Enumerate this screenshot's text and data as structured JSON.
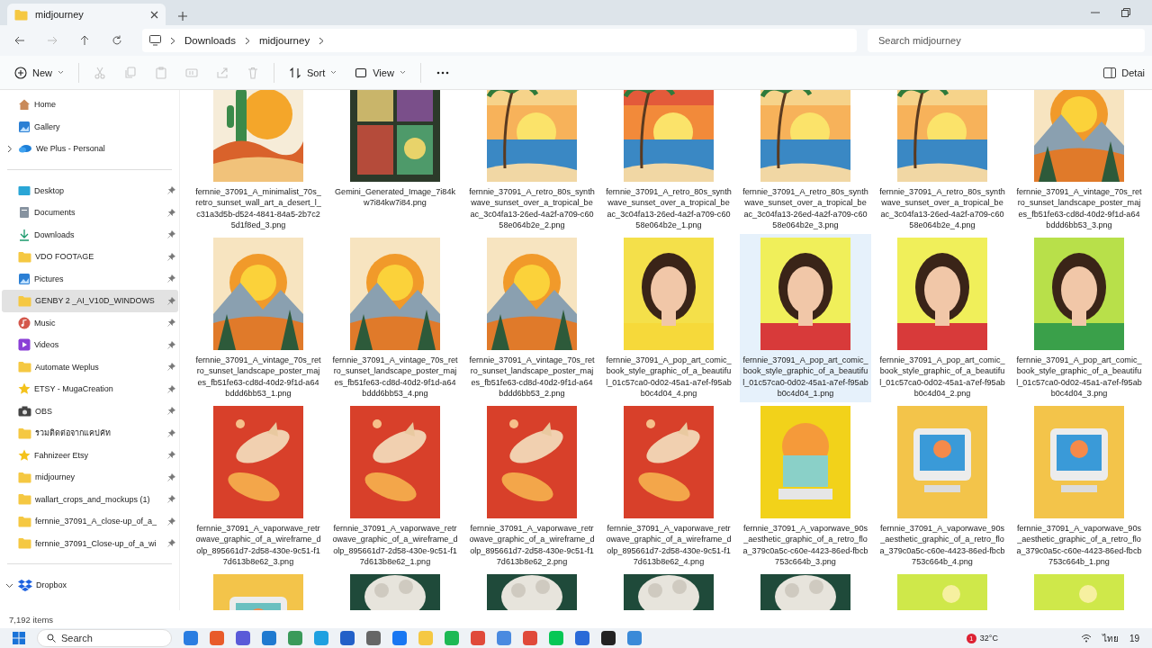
{
  "tab": {
    "title": "midjourney"
  },
  "address": {
    "crumbs": [
      "Downloads",
      "midjourney"
    ],
    "search": {
      "placeholder": "Search midjourney"
    }
  },
  "toolbar": [
    {
      "kind": "new",
      "label": "New",
      "disabled": false
    },
    {
      "kind": "cut",
      "disabled": true
    },
    {
      "kind": "copy",
      "disabled": true
    },
    {
      "kind": "paste",
      "disabled": true
    },
    {
      "kind": "rename",
      "disabled": true
    },
    {
      "kind": "share",
      "disabled": true
    },
    {
      "kind": "delete",
      "disabled": true
    },
    {
      "kind": "sort",
      "label": "Sort",
      "disabled": false
    },
    {
      "kind": "view",
      "label": "View",
      "disabled": false
    },
    {
      "kind": "more",
      "disabled": false
    }
  ],
  "details_button": {
    "label": "Detai"
  },
  "sidebar": {
    "top": [
      {
        "label": "Home",
        "kind": "home"
      },
      {
        "label": "Gallery",
        "kind": "gallery"
      },
      {
        "label": "We Plus - Personal",
        "kind": "cloud",
        "expanded": false
      }
    ],
    "pinned": [
      {
        "label": "Desktop",
        "kind": "desktop",
        "selected": false
      },
      {
        "label": "Documents",
        "kind": "documents",
        "selected": false
      },
      {
        "label": "Downloads",
        "kind": "download",
        "selected": false
      },
      {
        "label": "VDO FOOTAGE",
        "kind": "folder",
        "selected": false
      },
      {
        "label": "Pictures",
        "kind": "gallery",
        "selected": false
      },
      {
        "label": "GENBY 2 _AI_V10D_WINDOWS",
        "kind": "folder",
        "selected": true
      },
      {
        "label": "Music",
        "kind": "music",
        "selected": false
      },
      {
        "label": "Videos",
        "kind": "videos",
        "selected": false
      },
      {
        "label": "Automate Weplus",
        "kind": "folder",
        "selected": false
      },
      {
        "label": "ETSY - MugaCreation",
        "kind": "star",
        "selected": false
      },
      {
        "label": "OBS",
        "kind": "camera",
        "selected": false
      },
      {
        "label": "รวมติดต่อจากแคปคัท",
        "kind": "folder",
        "selected": false
      },
      {
        "label": "Fahnizeer Etsy",
        "kind": "star",
        "selected": false
      },
      {
        "label": "midjourney",
        "kind": "folder",
        "selected": false
      },
      {
        "label": "wallart_crops_and_mockups (1)",
        "kind": "folder",
        "selected": false
      },
      {
        "label": "fernnie_37091_A_close-up_of_a_",
        "kind": "folder",
        "selected": false
      },
      {
        "label": "fernnie_37091_Close-up_of_a_wi",
        "kind": "folder",
        "selected": false
      }
    ],
    "bottom": [
      {
        "label": "Dropbox",
        "kind": "dropbox",
        "expanded": true
      }
    ]
  },
  "files": [
    {
      "name": "fernnie_37091_A_minimalist_70s_retro_sunset_wall_art_a_desert_l_c31a3d5b-d524-4841-84a5-2b7c25d1f8ed_3.png",
      "selected": false
    },
    {
      "name": "Gemini_Generated_Image_7i84kw7i84kw7i84.png",
      "selected": false
    },
    {
      "name": "fernnie_37091_A_retro_80s_synthwave_sunset_over_a_tropical_beac_3c04fa13-26ed-4a2f-a709-c6058e064b2e_2.png",
      "selected": false
    },
    {
      "name": "fernnie_37091_A_retro_80s_synthwave_sunset_over_a_tropical_beac_3c04fa13-26ed-4a2f-a709-c6058e064b2e_1.png",
      "selected": false
    },
    {
      "name": "fernnie_37091_A_retro_80s_synthwave_sunset_over_a_tropical_beac_3c04fa13-26ed-4a2f-a709-c6058e064b2e_3.png",
      "selected": false
    },
    {
      "name": "fernnie_37091_A_retro_80s_synthwave_sunset_over_a_tropical_beac_3c04fa13-26ed-4a2f-a709-c6058e064b2e_4.png",
      "selected": false
    },
    {
      "name": "fernnie_37091_A_vintage_70s_retro_sunset_landscape_poster_majes_fb51fe63-cd8d-40d2-9f1d-a64bddd6bb53_3.png",
      "selected": false
    },
    {
      "name": "fernnie_37091_A_vintage_70s_retro_sunset_landscape_poster_majes_fb51fe63-cd8d-40d2-9f1d-a64bddd6bb53_1.png",
      "selected": false
    },
    {
      "name": "fernnie_37091_A_vintage_70s_retro_sunset_landscape_poster_majes_fb51fe63-cd8d-40d2-9f1d-a64bddd6bb53_4.png",
      "selected": false
    },
    {
      "name": "fernnie_37091_A_vintage_70s_retro_sunset_landscape_poster_majes_fb51fe63-cd8d-40d2-9f1d-a64bddd6bb53_2.png",
      "selected": false
    },
    {
      "name": "fernnie_37091_A_pop_art_comic_book_style_graphic_of_a_beautiful_01c57ca0-0d02-45a1-a7ef-f95abb0c4d04_4.png",
      "selected": false
    },
    {
      "name": "fernnie_37091_A_pop_art_comic_book_style_graphic_of_a_beautiful_01c57ca0-0d02-45a1-a7ef-f95abb0c4d04_1.png",
      "selected": true
    },
    {
      "name": "fernnie_37091_A_pop_art_comic_book_style_graphic_of_a_beautiful_01c57ca0-0d02-45a1-a7ef-f95abb0c4d04_2.png",
      "selected": false
    },
    {
      "name": "fernnie_37091_A_pop_art_comic_book_style_graphic_of_a_beautiful_01c57ca0-0d02-45a1-a7ef-f95abb0c4d04_3.png",
      "selected": false
    },
    {
      "name": "fernnie_37091_A_vaporwave_retrowave_graphic_of_a_wireframe_dolp_895661d7-2d58-430e-9c51-f17d613b8e62_3.png",
      "selected": false
    },
    {
      "name": "fernnie_37091_A_vaporwave_retrowave_graphic_of_a_wireframe_dolp_895661d7-2d58-430e-9c51-f17d613b8e62_1.png",
      "selected": false
    },
    {
      "name": "fernnie_37091_A_vaporwave_retrowave_graphic_of_a_wireframe_dolp_895661d7-2d58-430e-9c51-f17d613b8e62_2.png",
      "selected": false
    },
    {
      "name": "fernnie_37091_A_vaporwave_retrowave_graphic_of_a_wireframe_dolp_895661d7-2d58-430e-9c51-f17d613b8e62_4.png",
      "selected": false
    },
    {
      "name": "fernnie_37091_A_vaporwave_90s_aesthetic_graphic_of_a_retro_floa_379c0a5c-c60e-4423-86ed-fbcb753c664b_3.png",
      "selected": false
    },
    {
      "name": "fernnie_37091_A_vaporwave_90s_aesthetic_graphic_of_a_retro_floa_379c0a5c-c60e-4423-86ed-fbcb753c664b_4.png",
      "selected": false
    },
    {
      "name": "fernnie_37091_A_vaporwave_90s_aesthetic_graphic_of_a_retro_floa_379c0a5c-c60e-4423-86ed-fbcb753c664b_1.png",
      "selected": false
    },
    {
      "selected": false
    },
    {
      "selected": false
    },
    {
      "selected": false
    },
    {
      "selected": false
    },
    {
      "selected": false
    },
    {
      "selected": false
    },
    {
      "selected": false
    }
  ],
  "status_bar": {
    "count": "7,192 items"
  },
  "taskbar": {
    "search": {
      "placeholder": "Search"
    },
    "weather": {
      "temperature": "32°C",
      "badge": "1"
    },
    "language": "ไทย",
    "clock": "19"
  }
}
